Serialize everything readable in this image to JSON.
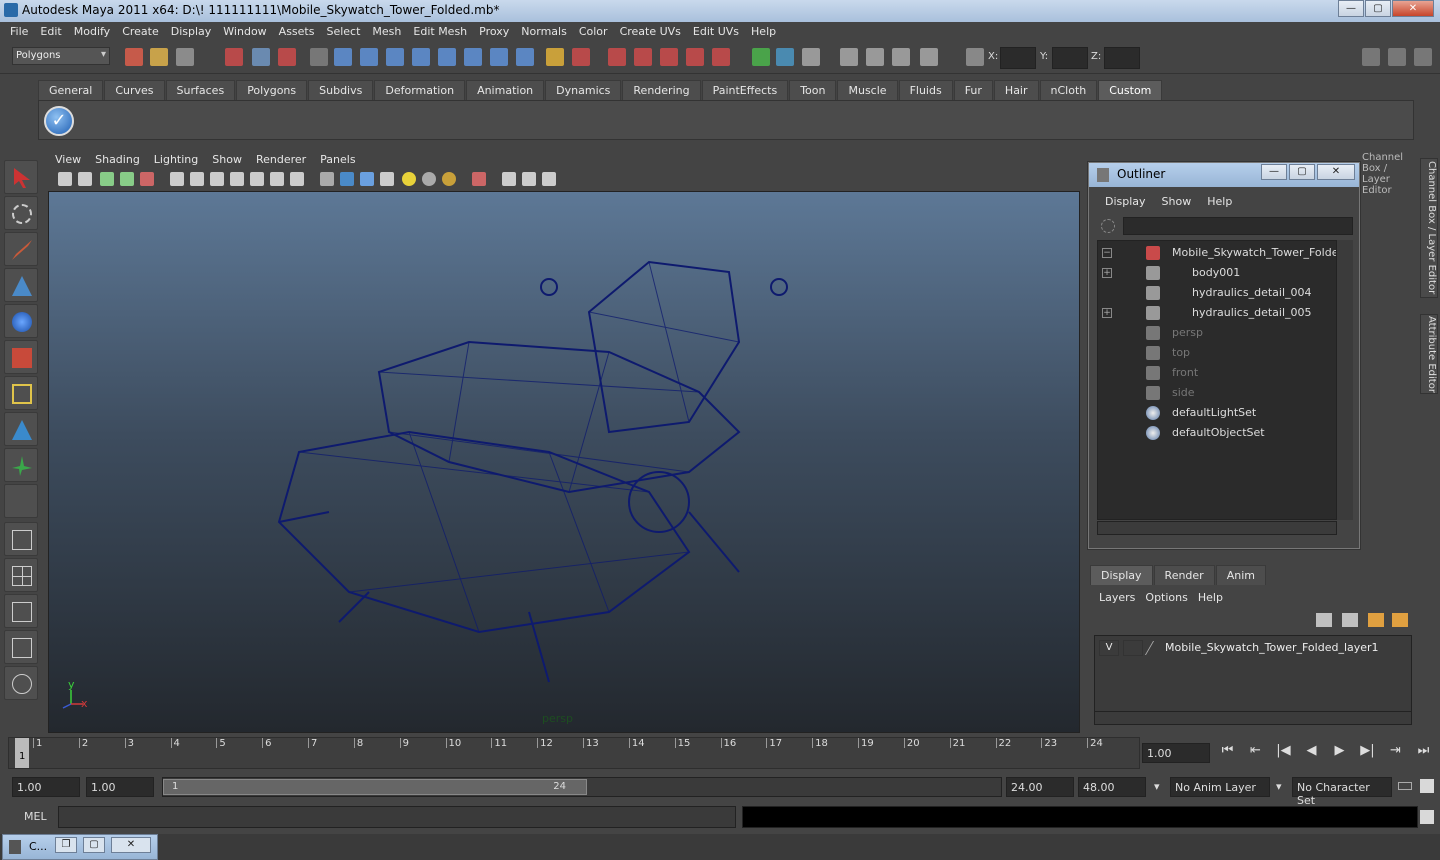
{
  "window": {
    "title": "Autodesk Maya 2011 x64: D:\\! 111111111\\Mobile_Skywatch_Tower_Folded.mb*",
    "min": "—",
    "max": "▢",
    "close": "✕"
  },
  "menubar": [
    "File",
    "Edit",
    "Modify",
    "Create",
    "Display",
    "Window",
    "Assets",
    "Select",
    "Mesh",
    "Edit Mesh",
    "Proxy",
    "Normals",
    "Color",
    "Create UVs",
    "Edit UVs",
    "Help"
  ],
  "statusline": {
    "mode": "Polygons",
    "x_label": "X:",
    "y_label": "Y:",
    "z_label": "Z:"
  },
  "shelf": {
    "tabs": [
      "General",
      "Curves",
      "Surfaces",
      "Polygons",
      "Subdivs",
      "Deformation",
      "Animation",
      "Dynamics",
      "Rendering",
      "PaintEffects",
      "Toon",
      "Muscle",
      "Fluids",
      "Fur",
      "Hair",
      "nCloth",
      "Custom"
    ],
    "active_tab": "Custom",
    "check_icon": "✓"
  },
  "panel": {
    "menu": [
      "View",
      "Shading",
      "Lighting",
      "Show",
      "Renderer",
      "Panels"
    ],
    "camera_label": "persp",
    "axis_x": "x",
    "axis_y": "y"
  },
  "outliner": {
    "title": "Outliner",
    "menu": [
      "Display",
      "Show",
      "Help"
    ],
    "expand_symbol": "+",
    "collapse_symbol": "−",
    "items": [
      {
        "label": "Mobile_Skywatch_Tower_Folded",
        "expander": "−",
        "dim": false,
        "icon": "mesh-group-icon"
      },
      {
        "label": "body001",
        "expander": "+",
        "dim": false,
        "icon": "mesh-icon"
      },
      {
        "label": "hydraulics_detail_004",
        "expander": "",
        "dim": false,
        "icon": "mesh-icon"
      },
      {
        "label": "hydraulics_detail_005",
        "expander": "+",
        "dim": false,
        "icon": "mesh-icon"
      },
      {
        "label": "persp",
        "expander": "",
        "dim": true,
        "icon": "camera-icon"
      },
      {
        "label": "top",
        "expander": "",
        "dim": true,
        "icon": "camera-icon"
      },
      {
        "label": "front",
        "expander": "",
        "dim": true,
        "icon": "camera-icon"
      },
      {
        "label": "side",
        "expander": "",
        "dim": true,
        "icon": "camera-icon"
      },
      {
        "label": "defaultLightSet",
        "expander": "",
        "dim": false,
        "icon": "set-icon"
      },
      {
        "label": "defaultObjectSet",
        "expander": "",
        "dim": false,
        "icon": "set-icon"
      }
    ]
  },
  "channel_box": {
    "header": "Channel Box / Layer Editor",
    "side_tabs": [
      "Channel Box / Layer Editor",
      "Attribute Editor"
    ]
  },
  "layer_editor": {
    "tabs": [
      "Display",
      "Render",
      "Anim"
    ],
    "active_tab": "Display",
    "menu": [
      "Layers",
      "Options",
      "Help"
    ],
    "layers": [
      {
        "visible": "V",
        "name": "Mobile_Skywatch_Tower_Folded_layer1"
      }
    ]
  },
  "timeline": {
    "ticks": [
      "1",
      "2",
      "3",
      "4",
      "5",
      "6",
      "7",
      "8",
      "9",
      "10",
      "11",
      "12",
      "13",
      "14",
      "15",
      "16",
      "17",
      "18",
      "19",
      "20",
      "21",
      "22",
      "23",
      "24"
    ],
    "current_frame": "1",
    "current_time": "1.00",
    "playback_buttons": [
      "⏮",
      "⇤",
      "|◀",
      "◀",
      "▶",
      "▶|",
      "⇥",
      "⏭"
    ]
  },
  "range": {
    "start": "1.00",
    "range_start": "1.00",
    "slider_start": "1",
    "slider_end": "24",
    "end": "24.00",
    "anim_end": "48.00",
    "anim_layer": "No Anim Layer",
    "char_set": "No Character Set"
  },
  "command": {
    "label": "MEL"
  },
  "taskbar": {
    "window_label": "C...",
    "restore": "❐",
    "max": "▢",
    "close": "✕"
  },
  "colors": {
    "wireframe": "#0e1a6e",
    "viewport_top": "#5d7896",
    "viewport_bottom": "#23282e",
    "accent": "#98b5d6"
  }
}
